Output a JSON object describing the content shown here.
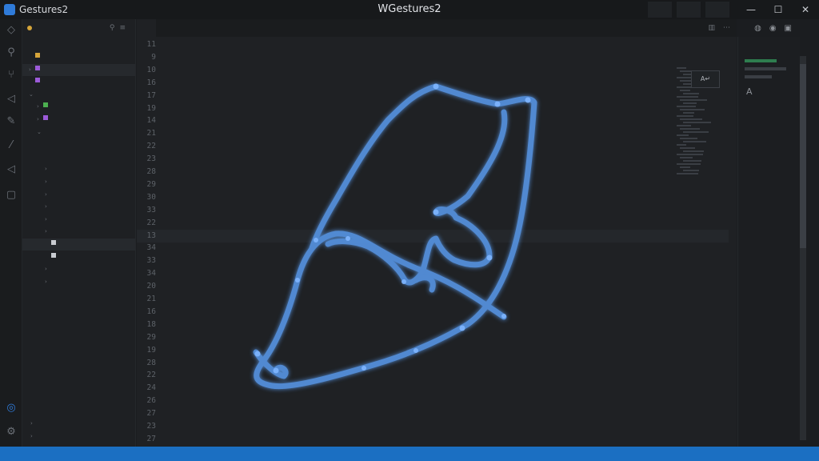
{
  "app": {
    "name": "Gestures2",
    "window_title": "WGestures2"
  },
  "title_tools": [
    "",
    "",
    ""
  ],
  "window_buttons": {
    "minimize": "—",
    "maximize": "☐",
    "close": "✕"
  },
  "sidebar": {
    "header": "",
    "items": [
      {
        "label": "",
        "active": false,
        "color": "#d6a53a",
        "depth": 0,
        "chev": ""
      },
      {
        "label": "",
        "active": true,
        "color": "#9c5bd8",
        "depth": 0,
        "chev": "›"
      },
      {
        "label": "",
        "active": false,
        "color": "#9c5bd8",
        "depth": 0,
        "chev": ""
      },
      {
        "label": "",
        "active": false,
        "color": "",
        "depth": 0,
        "chev": "⌄"
      },
      {
        "label": "",
        "active": false,
        "color": "#4caf50",
        "depth": 1,
        "chev": "›"
      },
      {
        "label": "",
        "active": false,
        "color": "#9c5bd8",
        "depth": 1,
        "chev": "›"
      },
      {
        "label": "",
        "active": false,
        "color": "",
        "depth": 1,
        "chev": "⌄"
      },
      {
        "label": "",
        "active": false,
        "color": "",
        "depth": 2,
        "chev": ""
      },
      {
        "label": "",
        "active": false,
        "color": "",
        "depth": 2,
        "chev": ""
      },
      {
        "label": "",
        "active": false,
        "color": "",
        "depth": 2,
        "chev": "›"
      },
      {
        "label": "",
        "active": false,
        "color": "",
        "depth": 2,
        "chev": "›"
      },
      {
        "label": "",
        "active": false,
        "color": "",
        "depth": 2,
        "chev": "›"
      },
      {
        "label": "",
        "active": false,
        "color": "",
        "depth": 2,
        "chev": "›"
      },
      {
        "label": "",
        "active": false,
        "color": "",
        "depth": 2,
        "chev": "›"
      },
      {
        "label": "",
        "active": false,
        "color": "",
        "depth": 2,
        "chev": "›"
      },
      {
        "label": "",
        "active": true,
        "color": "#c9ccd1",
        "depth": 2,
        "chev": ""
      },
      {
        "label": "",
        "active": false,
        "color": "#c9ccd1",
        "depth": 2,
        "chev": ""
      },
      {
        "label": "",
        "active": false,
        "color": "",
        "depth": 2,
        "chev": "›"
      },
      {
        "label": "",
        "active": false,
        "color": "",
        "depth": 2,
        "chev": "›"
      },
      {
        "label": "",
        "active": false,
        "color": "",
        "depth": 2,
        "chev": ""
      }
    ],
    "footer_items": [
      {
        "label": "",
        "chev": "›"
      },
      {
        "label": "",
        "chev": "›"
      }
    ]
  },
  "tabs": [
    {
      "label": "",
      "active": true
    },
    {
      "label": "",
      "active": false
    },
    {
      "label": "",
      "active": false
    }
  ],
  "editor": {
    "lines": [
      {
        "n": "11",
        "code": ""
      },
      {
        "n": "9",
        "code": ""
      },
      {
        "n": "10",
        "code": ""
      },
      {
        "n": "16",
        "code": ""
      },
      {
        "n": "17",
        "code": ""
      },
      {
        "n": "19",
        "code": ""
      },
      {
        "n": "14",
        "code": ""
      },
      {
        "n": "21",
        "code": ""
      },
      {
        "n": "22",
        "code": ""
      },
      {
        "n": "23",
        "code": ""
      },
      {
        "n": "28",
        "code": ""
      },
      {
        "n": "29",
        "code": ""
      },
      {
        "n": "30",
        "code": ""
      },
      {
        "n": "33",
        "code": ""
      },
      {
        "n": "22",
        "code": ""
      },
      {
        "n": "13",
        "code": ""
      },
      {
        "n": "34",
        "code": ""
      },
      {
        "n": "33",
        "code": ""
      },
      {
        "n": "34",
        "code": ""
      },
      {
        "n": "20",
        "code": ""
      },
      {
        "n": "21",
        "code": ""
      },
      {
        "n": "16",
        "code": ""
      },
      {
        "n": "18",
        "code": ""
      },
      {
        "n": "29",
        "code": ""
      },
      {
        "n": "19",
        "code": ""
      },
      {
        "n": "28",
        "code": ""
      },
      {
        "n": "22",
        "code": ""
      },
      {
        "n": "24",
        "code": ""
      },
      {
        "n": "26",
        "code": ""
      },
      {
        "n": "27",
        "code": ""
      },
      {
        "n": "23",
        "code": ""
      },
      {
        "n": "27",
        "code": ""
      }
    ],
    "current_line_index": 15
  },
  "right_panel": {
    "title": "",
    "label": "A"
  },
  "statusbar": {
    "left": "",
    "right": [
      "",
      "",
      "",
      ""
    ]
  },
  "colors": {
    "accent": "#1b6fc2",
    "gesture": "#5a9cf0"
  }
}
